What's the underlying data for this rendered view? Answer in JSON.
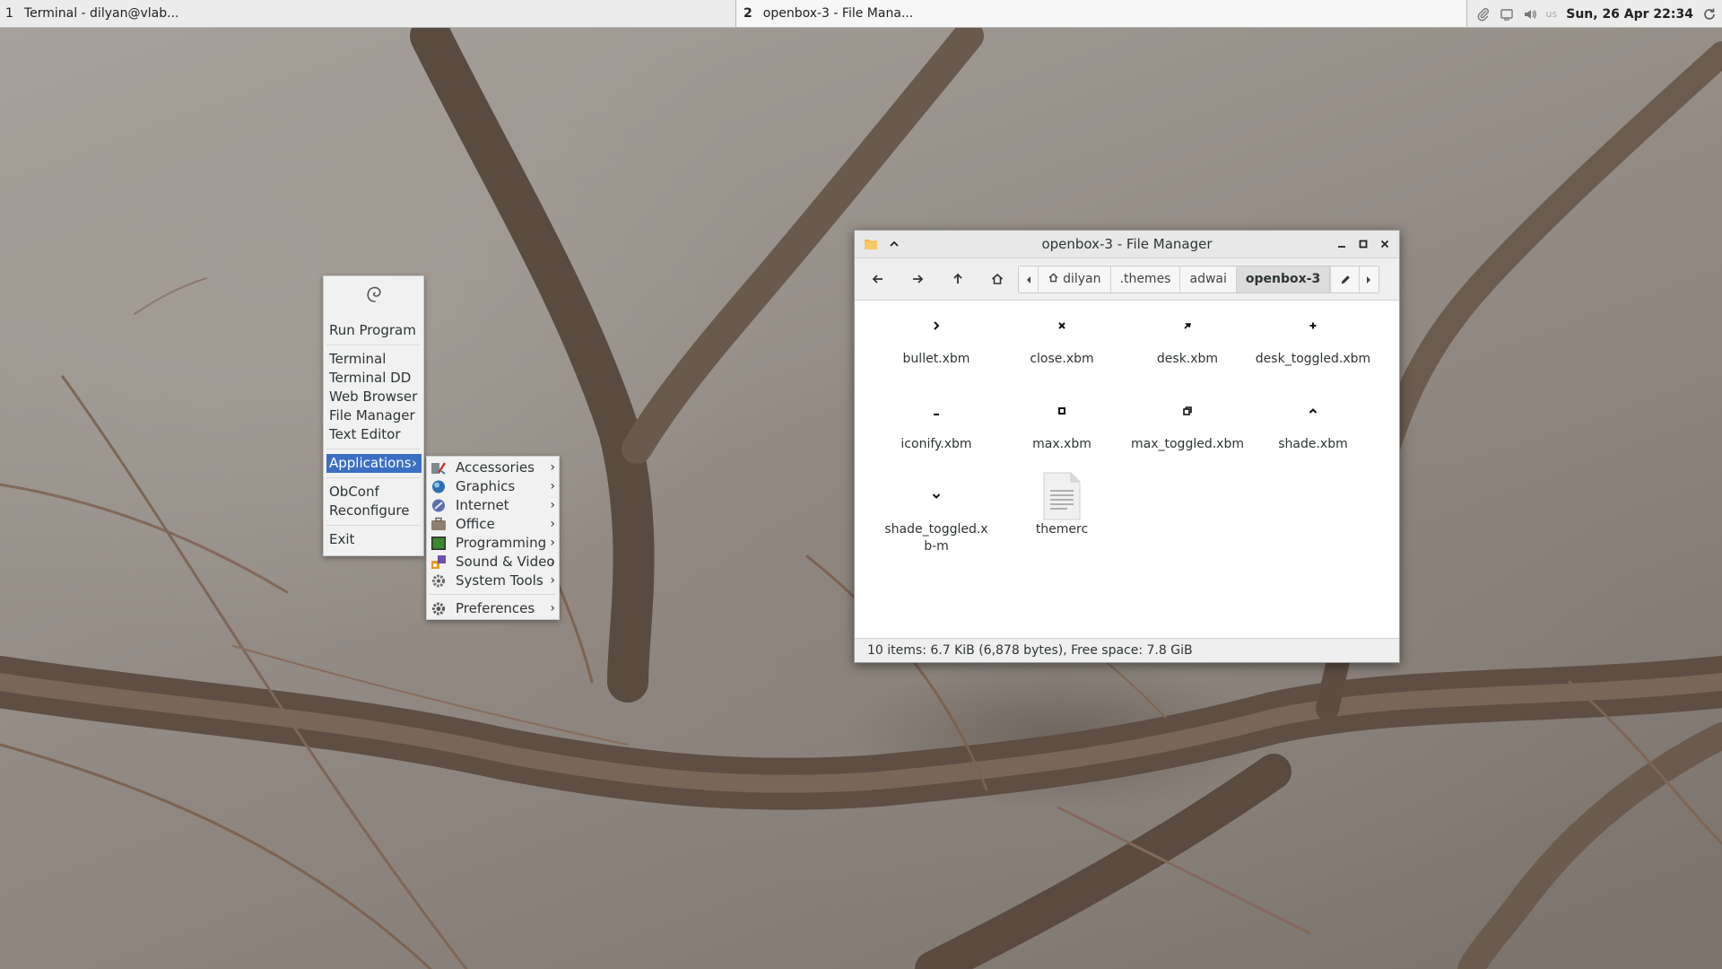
{
  "taskbar": {
    "tasks": [
      {
        "num": "1",
        "label": "Terminal - dilyan@vlab..."
      },
      {
        "num": "2",
        "label": "openbox-3 - File Mana..."
      }
    ],
    "tray_icons": [
      "paperclip-icon",
      "window-icon",
      "volume-icon",
      "keyboard-layout-icon",
      "refresh-icon"
    ],
    "keyboard_layout": "us",
    "clock": "Sun, 26 Apr 22:34"
  },
  "root_menu": {
    "logo": "debian-swirl-icon",
    "items": [
      "Run Program",
      "Terminal",
      "Terminal DD",
      "Web Browser",
      "File Manager",
      "Text Editor",
      "Applications",
      "ObConf",
      "Reconfigure",
      "Exit"
    ],
    "submenu_arrow": "›"
  },
  "apps_menu": {
    "items": [
      {
        "label": "Accessories",
        "icon": "accessories-icon"
      },
      {
        "label": "Graphics",
        "icon": "graphics-icon"
      },
      {
        "label": "Internet",
        "icon": "internet-icon"
      },
      {
        "label": "Office",
        "icon": "office-icon"
      },
      {
        "label": "Programming",
        "icon": "programming-icon"
      },
      {
        "label": "Sound & Video",
        "icon": "sound-video-icon"
      },
      {
        "label": "System Tools",
        "icon": "system-tools-icon"
      },
      {
        "label": "Preferences",
        "icon": "preferences-icon"
      }
    ],
    "arrow": "›"
  },
  "file_manager": {
    "title": "openbox-3 - File Manager",
    "breadcrumbs": [
      "dilyan",
      ".themes",
      "adwai",
      "openbox-3"
    ],
    "files": [
      {
        "name": "bullet.xbm",
        "glyph": "›"
      },
      {
        "name": "close.xbm",
        "glyph": "×"
      },
      {
        "name": "desk.xbm",
        "glyph": "pin"
      },
      {
        "name": "desk_toggled.xbm",
        "glyph": "+"
      },
      {
        "name": "iconify.xbm",
        "glyph": "_"
      },
      {
        "name": "max.xbm",
        "glyph": "square"
      },
      {
        "name": "max_toggled.xbm",
        "glyph": "restore"
      },
      {
        "name": "shade.xbm",
        "glyph": "^"
      },
      {
        "name": "shade_toggled.xb-m",
        "glyph": "v"
      },
      {
        "name": "themerc",
        "glyph": "text-file"
      }
    ],
    "status": "10 items: 6.7 KiB (6,878 bytes), Free space: 7.8 GiB"
  },
  "colors": {
    "menu_highlight": "#3a6fc4",
    "panel_bg": "#ececec",
    "window_bg": "#ffffff"
  }
}
